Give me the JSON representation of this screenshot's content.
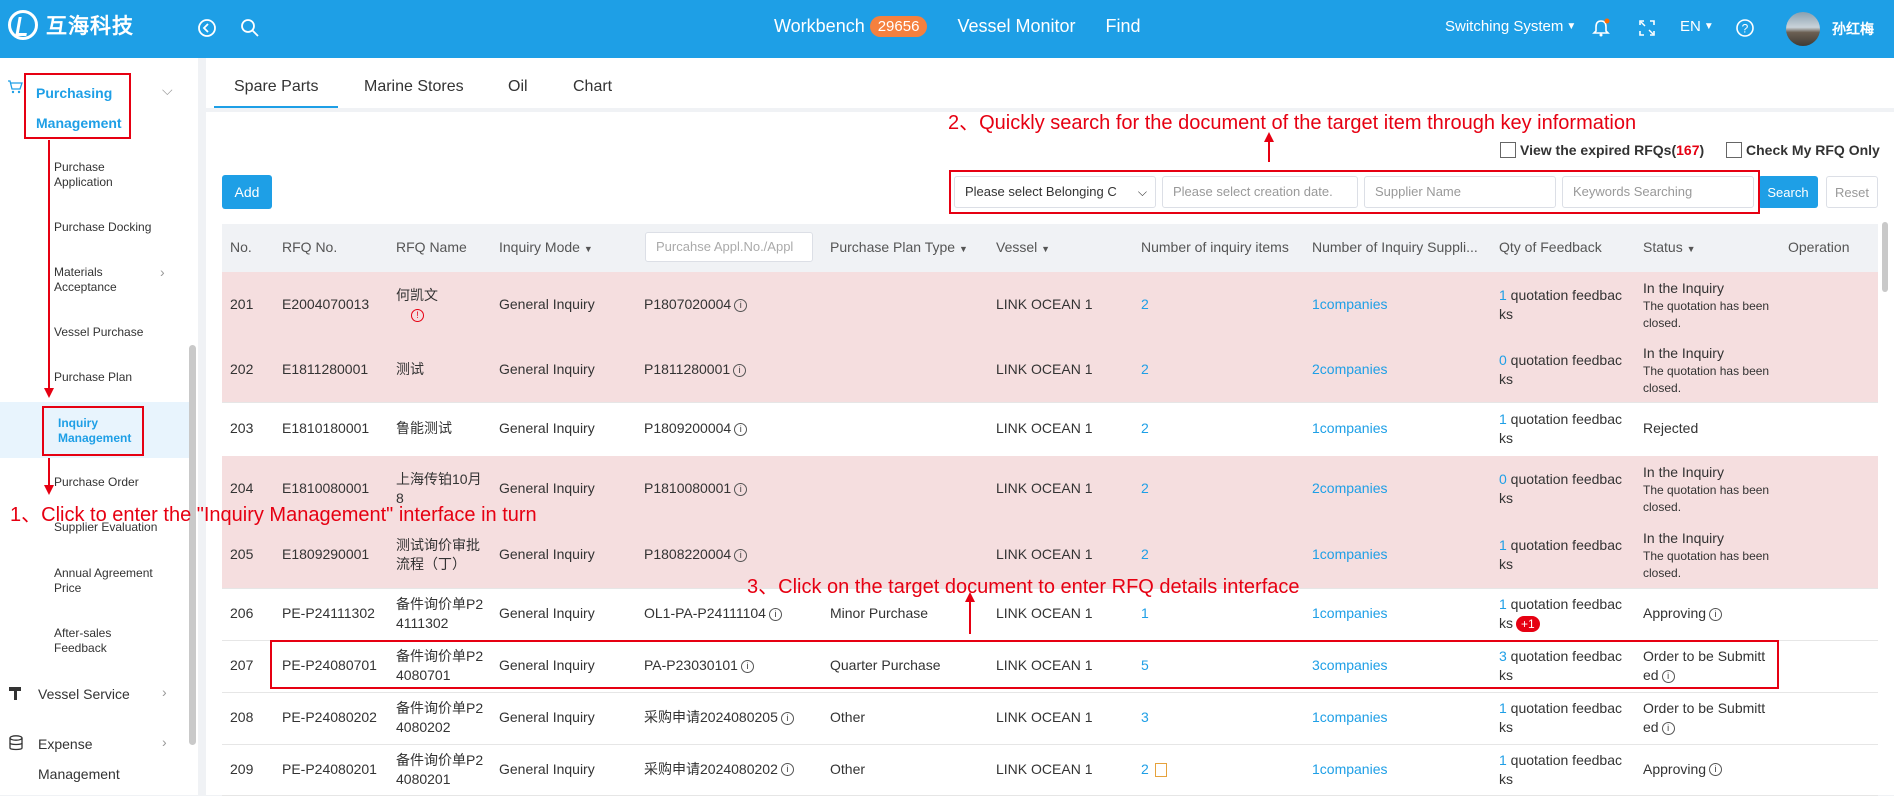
{
  "topbar": {
    "brand": "互海科技",
    "nav": [
      {
        "label": "Workbench",
        "badge": "29656"
      },
      {
        "label": "Vessel Monitor"
      },
      {
        "label": "Find"
      }
    ],
    "switching": "Switching System",
    "lang": "EN",
    "user": "孙红梅"
  },
  "sidebar": {
    "group_line1": "Purchasing",
    "group_line2": "Management",
    "items": [
      {
        "l1": "Purchase",
        "l2": "Application"
      },
      {
        "l1": "Purchase Docking",
        "l2": ""
      },
      {
        "l1": "Materials",
        "l2": "Acceptance"
      },
      {
        "l1": "Vessel Purchase",
        "l2": ""
      },
      {
        "l1": "Purchase Plan",
        "l2": ""
      },
      {
        "l1": "Inquiry",
        "l2": "Management"
      },
      {
        "l1": "Purchase Order",
        "l2": ""
      },
      {
        "l1": "Supplier Evaluation",
        "l2": ""
      },
      {
        "l1": "Annual Agreement",
        "l2": "Price"
      },
      {
        "l1": "After-sales",
        "l2": "Feedback"
      }
    ],
    "vessel_service": "Vessel Service",
    "expense": "Expense",
    "expense2": "Management"
  },
  "tabs": [
    "Spare Parts",
    "Marine Stores",
    "Oil",
    "Chart"
  ],
  "toolbar": {
    "add": "Add",
    "belonging": "Please select Belonging C",
    "date": "Please select creation date.",
    "supplier": "Supplier Name",
    "keywords": "Keywords Searching",
    "search": "Search",
    "reset": "Reset",
    "expired_label": "View the expired RFQs(",
    "expired_count": "167",
    "expired_close": ")",
    "my_rfq": "Check My RFQ Only"
  },
  "table": {
    "headers": {
      "no": "No.",
      "rfq_no": "RFQ No.",
      "rfq_name": "RFQ Name",
      "mode": "Inquiry Mode",
      "appl_placeholder": "Purcahse Appl.No./Appl",
      "plan_type": "Purchase Plan Type",
      "vessel": "Vessel",
      "items": "Number of inquiry items",
      "suppliers": "Number of Inquiry Suppli...",
      "feedback": "Qty of Feedback",
      "status": "Status",
      "operation": "Operation"
    },
    "rows": [
      {
        "no": "201",
        "rfq": "E2004070013",
        "name1": "何凯文",
        "name2": "",
        "mode": "General Inquiry",
        "appl": "P1807020004",
        "plan": "",
        "vessel": "LINK OCEAN 1",
        "items": "2",
        "sup": "1companies",
        "fb": "1",
        "fb_text1": " quotation feedbac",
        "fb_text2": "ks",
        "st1": "In the Inquiry",
        "st2": "The quotation has been",
        "st3": "closed.",
        "plus": ""
      },
      {
        "no": "202",
        "rfq": "E1811280001",
        "name1": "测试",
        "name2": "",
        "mode": "General Inquiry",
        "appl": "P1811280001",
        "plan": "",
        "vessel": "LINK OCEAN 1",
        "items": "2",
        "sup": "2companies",
        "fb": "0",
        "fb_text1": " quotation feedbac",
        "fb_text2": "ks",
        "st1": "In the Inquiry",
        "st2": "The quotation has been",
        "st3": "closed.",
        "plus": ""
      },
      {
        "no": "203",
        "rfq": "E1810180001",
        "name1": "鲁能测试",
        "name2": "",
        "mode": "General Inquiry",
        "appl": "P1809200004",
        "plan": "",
        "vessel": "LINK OCEAN 1",
        "items": "2",
        "sup": "1companies",
        "fb": "1",
        "fb_text1": " quotation feedbac",
        "fb_text2": "ks",
        "st1": "Rejected",
        "st2": "",
        "st3": "",
        "plus": ""
      },
      {
        "no": "204",
        "rfq": "E1810080001",
        "name1": "上海传铂10月",
        "name2": "8",
        "mode": "General Inquiry",
        "appl": "P1810080001",
        "plan": "",
        "vessel": "LINK OCEAN 1",
        "items": "2",
        "sup": "2companies",
        "fb": "0",
        "fb_text1": " quotation feedbac",
        "fb_text2": "ks",
        "st1": "In the Inquiry",
        "st2": "The quotation has been",
        "st3": "closed.",
        "plus": ""
      },
      {
        "no": "205",
        "rfq": "E1809290001",
        "name1": "测试询价审批",
        "name2": "流程（丁）",
        "mode": "General Inquiry",
        "appl": "P1808220004",
        "plan": "",
        "vessel": "LINK OCEAN 1",
        "items": "2",
        "sup": "1companies",
        "fb": "1",
        "fb_text1": " quotation feedbac",
        "fb_text2": "ks",
        "st1": "In the Inquiry",
        "st2": "The quotation has been",
        "st3": "closed.",
        "plus": ""
      },
      {
        "no": "206",
        "rfq": "PE-P24111302",
        "name1": "备件询价单P2",
        "name2": "4111302",
        "mode": "General Inquiry",
        "appl": "OL1-PA-P24111104",
        "plan": "Minor Purchase",
        "vessel": "LINK OCEAN 1",
        "items": "1",
        "sup": "1companies",
        "fb": "1",
        "fb_text1": " quotation feedbac",
        "fb_text2": "ks",
        "st1": "Approving",
        "st2": "",
        "st3": "",
        "plus": "+1"
      },
      {
        "no": "207",
        "rfq": "PE-P24080701",
        "name1": "备件询价单P2",
        "name2": "4080701",
        "mode": "General Inquiry",
        "appl": "PA-P23030101",
        "plan": "Quarter Purchase",
        "vessel": "LINK OCEAN 1",
        "items": "5",
        "sup": "3companies",
        "fb": "3",
        "fb_text1": " quotation feedbac",
        "fb_text2": "ks",
        "st1": "Order to be Submitt",
        "st2": "ed",
        "st3": "",
        "plus": ""
      },
      {
        "no": "208",
        "rfq": "PE-P24080202",
        "name1": "备件询价单P2",
        "name2": "4080202",
        "mode": "General Inquiry",
        "appl": "采购申请2024080205",
        "plan": "Other",
        "vessel": "LINK OCEAN 1",
        "items": "3",
        "sup": "1companies",
        "fb": "1",
        "fb_text1": " quotation feedbac",
        "fb_text2": "ks",
        "st1": "Order to be Submitt",
        "st2": "ed",
        "st3": "",
        "plus": ""
      },
      {
        "no": "209",
        "rfq": "PE-P24080201",
        "name1": "备件询价单P2",
        "name2": "4080201",
        "mode": "General Inquiry",
        "appl": "采购申请2024080202",
        "plan": "Other",
        "vessel": "LINK OCEAN 1",
        "items": "2",
        "sup": "1companies",
        "fb": "1",
        "fb_text1": " quotation feedbac",
        "fb_text2": "ks",
        "st1": "Approving",
        "st2": "",
        "st3": "",
        "plus": ""
      }
    ]
  },
  "annotations": {
    "step1": "1、Click to enter the \"Inquiry Management\" interface in turn",
    "step2": "2、Quickly search for the document of the target item through key information",
    "step3": "3、Click on the target document to enter RFQ details interface"
  }
}
